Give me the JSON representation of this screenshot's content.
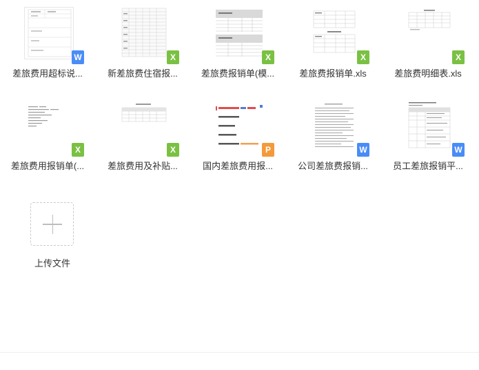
{
  "files": [
    {
      "name": "差旅费用超标说...",
      "type": "w",
      "icon": "word-icon"
    },
    {
      "name": "新差旅费住宿报...",
      "type": "x",
      "icon": "excel-icon"
    },
    {
      "name": "差旅费报销单(模...",
      "type": "x",
      "icon": "excel-icon"
    },
    {
      "name": "差旅费报销单.xls",
      "type": "x",
      "icon": "excel-icon"
    },
    {
      "name": "差旅费明细表.xls",
      "type": "x",
      "icon": "excel-icon"
    },
    {
      "name": "差旅费用报销单(...",
      "type": "x",
      "icon": "excel-icon"
    },
    {
      "name": "差旅费用及补贴...",
      "type": "x",
      "icon": "excel-icon"
    },
    {
      "name": "国内差旅费用报...",
      "type": "p",
      "icon": "ppt-icon"
    },
    {
      "name": "公司差旅费报销...",
      "type": "w",
      "icon": "word-icon"
    },
    {
      "name": "员工差旅报销平...",
      "type": "w",
      "icon": "word-icon"
    }
  ],
  "badges": {
    "w": "W",
    "x": "X",
    "p": "P"
  },
  "upload": {
    "label": "上传文件",
    "icon": "plus-icon"
  },
  "colors": {
    "word": "#4a8cf7",
    "excel": "#7ac143",
    "ppt": "#f39a3b"
  }
}
